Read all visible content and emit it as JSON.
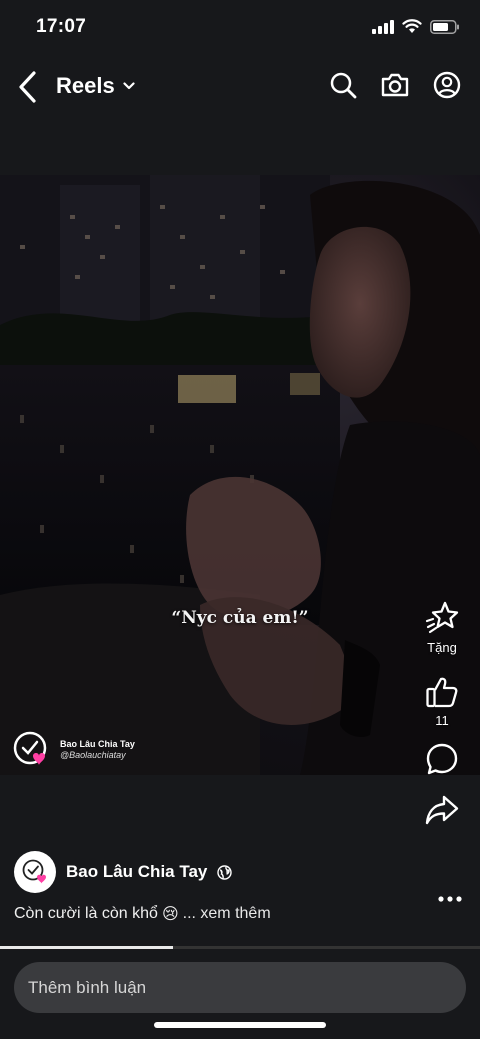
{
  "status_bar": {
    "time": "17:07"
  },
  "header": {
    "title": "Reels"
  },
  "video": {
    "overlay_caption": "“Nyc của em!”",
    "watermark_name": "Bao Lâu Chia Tay",
    "watermark_handle": "@Baolauchiatay"
  },
  "actions": {
    "gift_label": "Tặng",
    "like_count": "11"
  },
  "post": {
    "author": "Bao Lâu Chia Tay",
    "caption": "Còn cười là còn khổ",
    "caption_emoji": "😢",
    "see_more": "... xem thêm",
    "progress": 0.36
  },
  "comment": {
    "placeholder": "Thêm bình luận"
  }
}
